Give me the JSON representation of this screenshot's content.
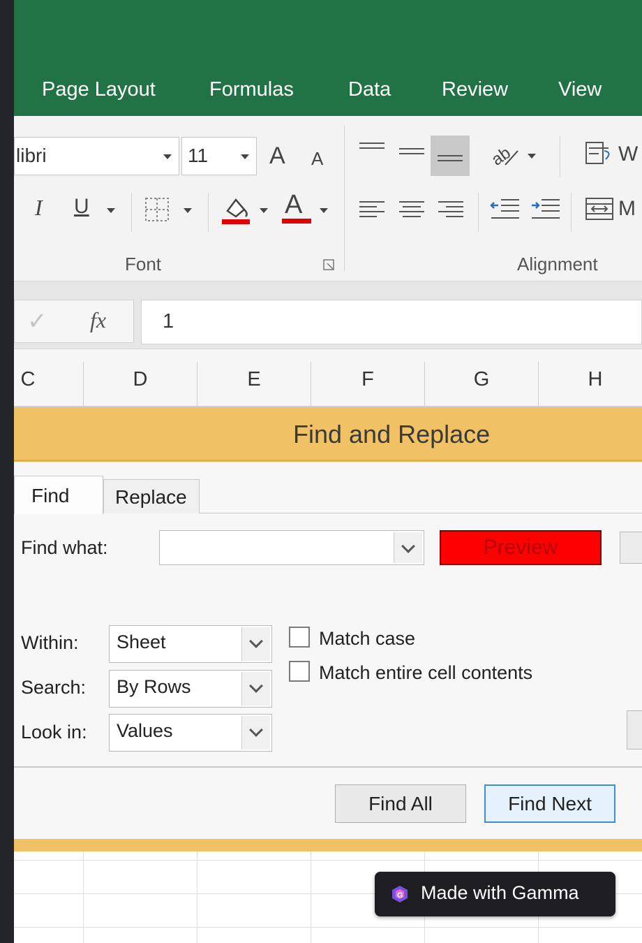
{
  "tabs": [
    "Page Layout",
    "Formulas",
    "Data",
    "Review",
    "View"
  ],
  "font": {
    "name_value": "libri",
    "size_value": "11",
    "grow_glyph": "A",
    "shrink_glyph": "A",
    "italic_glyph": "I",
    "underline_glyph": "U",
    "font_color_glyph": "A",
    "group_label": "Font"
  },
  "alignment": {
    "wrap_label_partial": "W",
    "merge_label_partial": "M",
    "group_label": "Alignment"
  },
  "formula_bar": {
    "enter_glyph": "✓",
    "fx_label": "fx",
    "value": "1"
  },
  "columns": [
    "C",
    "D",
    "E",
    "F",
    "G",
    "H"
  ],
  "dialog": {
    "title": "Find and Replace",
    "tabs": [
      "Find",
      "Replace"
    ],
    "find_what_label": "Find what:",
    "find_what_value": "",
    "preview_label": "Preview",
    "within_label": "Within:",
    "within_value": "Sheet",
    "search_label": "Search:",
    "search_value": "By Rows",
    "look_in_label": "Look in:",
    "look_in_value": "Values",
    "match_case_label": "Match case",
    "match_entire_label": "Match entire cell contents",
    "find_all_label": "Find All",
    "find_next_label": "Find Next"
  },
  "badge": {
    "label": "Made with Gamma"
  },
  "colors": {
    "ribbon_green": "#217346",
    "dialog_title_bg": "#f1c165",
    "preview_bg": "#ff0000",
    "preview_text": "#b30000",
    "font_color_bar": "#e00000"
  }
}
